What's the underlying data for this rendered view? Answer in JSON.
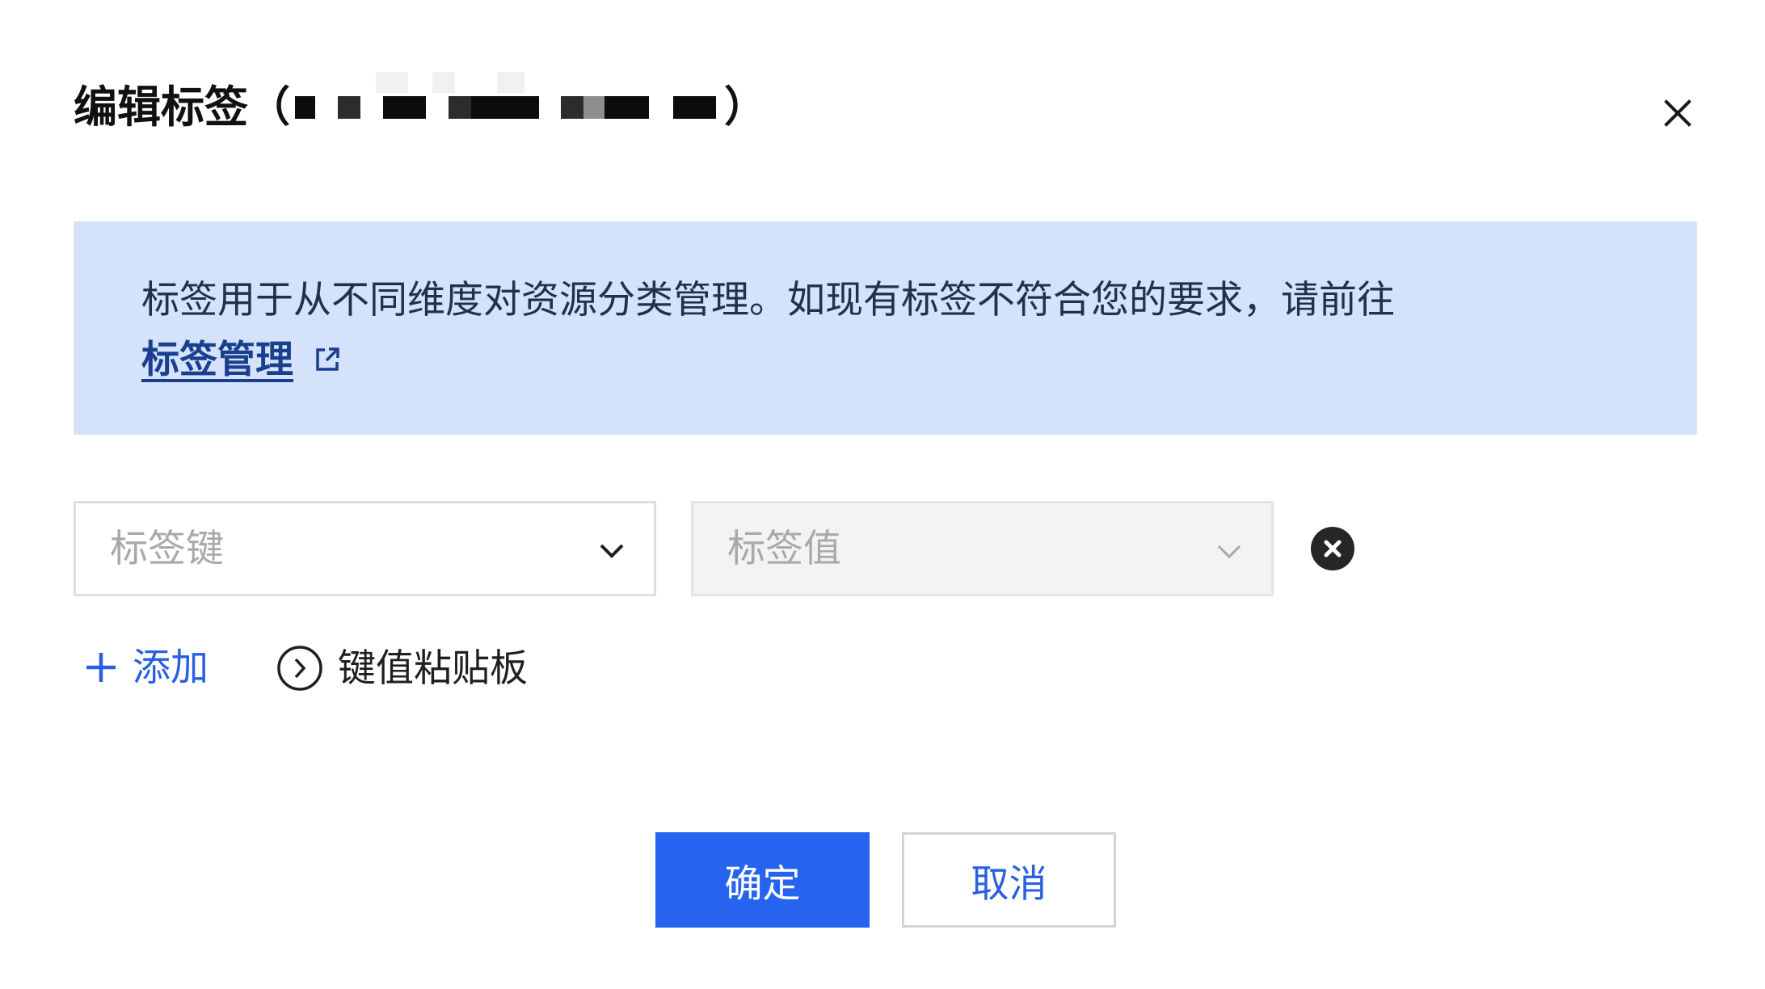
{
  "dialog": {
    "title": "编辑标签",
    "paren_open": "（",
    "paren_close": "）",
    "close_icon": "close-icon"
  },
  "notice": {
    "text": "标签用于从不同维度对资源分类管理。如现有标签不符合您的要求，请前往",
    "link_label": "标签管理",
    "link_icon": "external-link-icon"
  },
  "tag_row": {
    "key_placeholder": "标签键",
    "value_placeholder": "标签值",
    "chevron_icon": "chevron-down-icon",
    "remove_icon": "remove-circle-icon"
  },
  "actions": {
    "add_icon": "plus-icon",
    "add_label": "添加",
    "paste_icon": "chevron-right-circle-icon",
    "paste_label": "键值粘贴板"
  },
  "footer": {
    "confirm_label": "确定",
    "cancel_label": "取消"
  },
  "colors": {
    "primary": "#2664ef",
    "banner_bg": "#d5e2fb",
    "link_dark": "#1b3f8f",
    "link_blue": "#2a5fe0"
  }
}
